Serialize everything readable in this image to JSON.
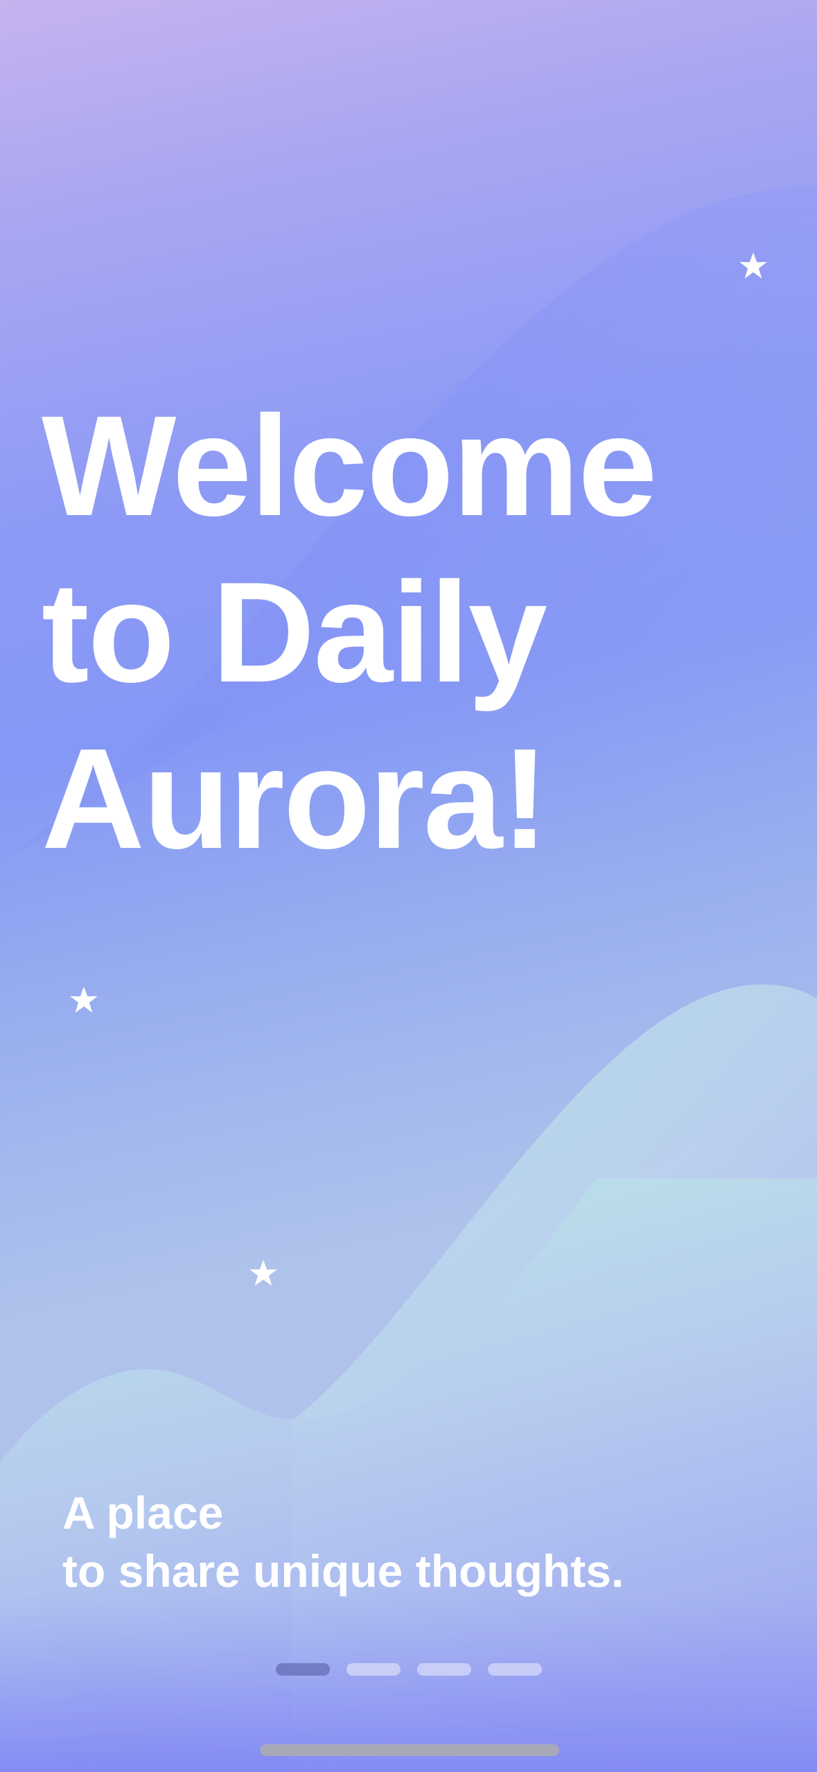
{
  "app": {
    "name": "Daily Aurora"
  },
  "onboarding": {
    "headline_lines": [
      "Welcome",
      "to Daily",
      "Aurora!"
    ],
    "subtitle_lines": [
      "A place",
      "to share unique thoughts."
    ],
    "pager": {
      "total_pages": 4,
      "current_page": 1
    }
  },
  "decorations": {
    "stars": [
      "star-icon",
      "star-icon",
      "star-icon"
    ]
  },
  "colors": {
    "text": "#ffffff",
    "gradient_top": "#c6b3ee",
    "gradient_mid": "#8598f5",
    "wave_mint": "#b8e8e3",
    "pager_active": "#6a6fb0",
    "pager_inactive": "#d8dcf7",
    "home_indicator": "#a7a9b8"
  }
}
